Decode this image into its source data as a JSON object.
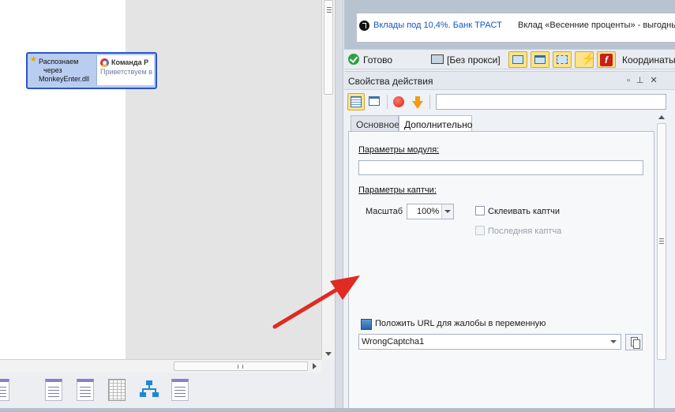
{
  "canvas": {
    "node": {
      "label_lines": [
        "Распознаем",
        "через",
        "MonkeyEnter.dll"
      ],
      "preview_title": "Команда Р",
      "preview_subtitle": "Приветствуем в"
    }
  },
  "browser": {
    "banner_link": "Вклады под 10,4%. Банк ТРАСТ",
    "banner_text": "Вклад «Весенние проценты» - выгодные у"
  },
  "status_bar": {
    "ready_label": "Готово",
    "proxy_label": "[Без прокси]",
    "coords_label": "Координаты"
  },
  "properties": {
    "title": "Свойства действия",
    "filter_value": "",
    "tabs": [
      {
        "label": "Основное",
        "active": false
      },
      {
        "label": "Дополнительно",
        "active": true
      }
    ],
    "module_params_label": "Параметры модуля:",
    "module_params_value": "",
    "captcha_params_label": "Параметры каптчи:",
    "scale_label": "Масштаб",
    "scale_value": "100%",
    "glue_captcha_label": "Склеивать каптчи",
    "last_captcha_label": "Последняя каптча",
    "url_var_label": "Положить URL для жалобы в переменную",
    "url_var_value": "WrongCaptcha1"
  },
  "colors": {
    "accent_yellow": "#fbe38a",
    "node_border": "#2c55c9",
    "annotation_arrow": "#e02a22",
    "link_blue": "#1556c4"
  }
}
